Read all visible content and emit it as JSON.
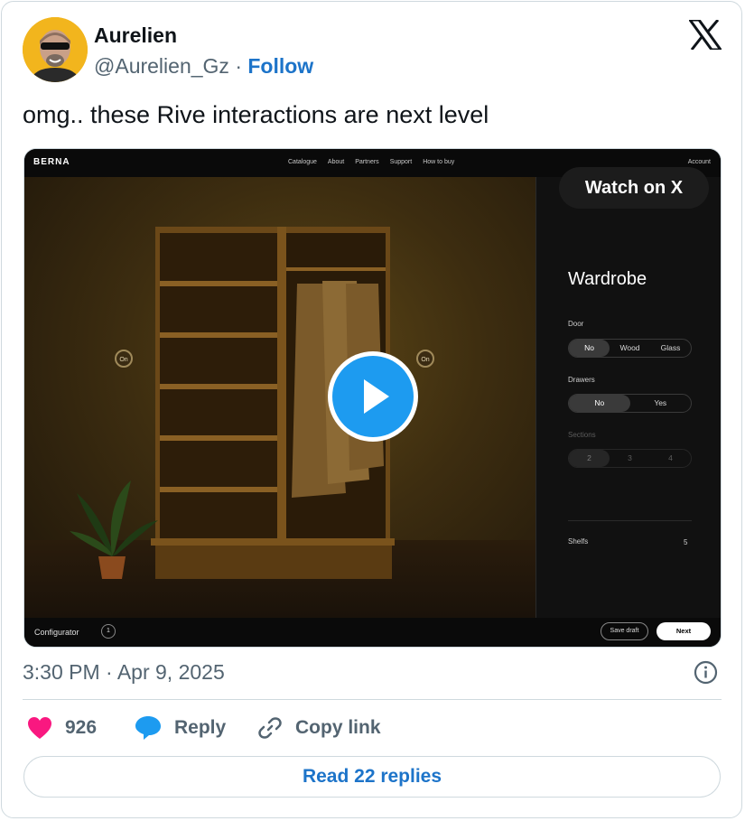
{
  "author": {
    "name": "Aurelien",
    "handle": "@Aurelien_Gz",
    "separator": "·",
    "follow_label": "Follow"
  },
  "tweet": {
    "text": "omg.. these Rive interactions are next level",
    "timestamp": "3:30 PM · Apr 9, 2025"
  },
  "media": {
    "watch_label": "Watch on X",
    "site": {
      "brand": "BERNA",
      "nav": [
        "Catalogue",
        "About",
        "Partners",
        "Support",
        "How to buy"
      ],
      "account": "Account",
      "hotspot_label": "On",
      "panel": {
        "title": "Wardrobe",
        "door": {
          "label": "Door",
          "options": [
            "No",
            "Wood",
            "Glass"
          ],
          "selected": "No"
        },
        "drawers": {
          "label": "Drawers",
          "options": [
            "No",
            "Yes"
          ],
          "selected": "No"
        },
        "sections": {
          "label": "Sections",
          "options": [
            "2",
            "3",
            "4"
          ],
          "selected": "2"
        },
        "shelfs": {
          "label": "Shelfs",
          "value": "5"
        }
      },
      "bottom": {
        "configurator_label": "Configurator",
        "step": "1",
        "save_draft": "Save draft",
        "next": "Next"
      }
    }
  },
  "actions": {
    "like_count": "926",
    "reply_label": "Reply",
    "copy_link_label": "Copy link"
  },
  "read_replies": "Read 22 replies",
  "colors": {
    "like": "#f91880",
    "link": "#1d74c9",
    "play": "#1d9bf0",
    "text_muted": "#536471"
  },
  "icons": [
    "x-logo-icon",
    "heart-icon",
    "reply-bubble-icon",
    "link-icon",
    "info-icon",
    "play-icon"
  ]
}
